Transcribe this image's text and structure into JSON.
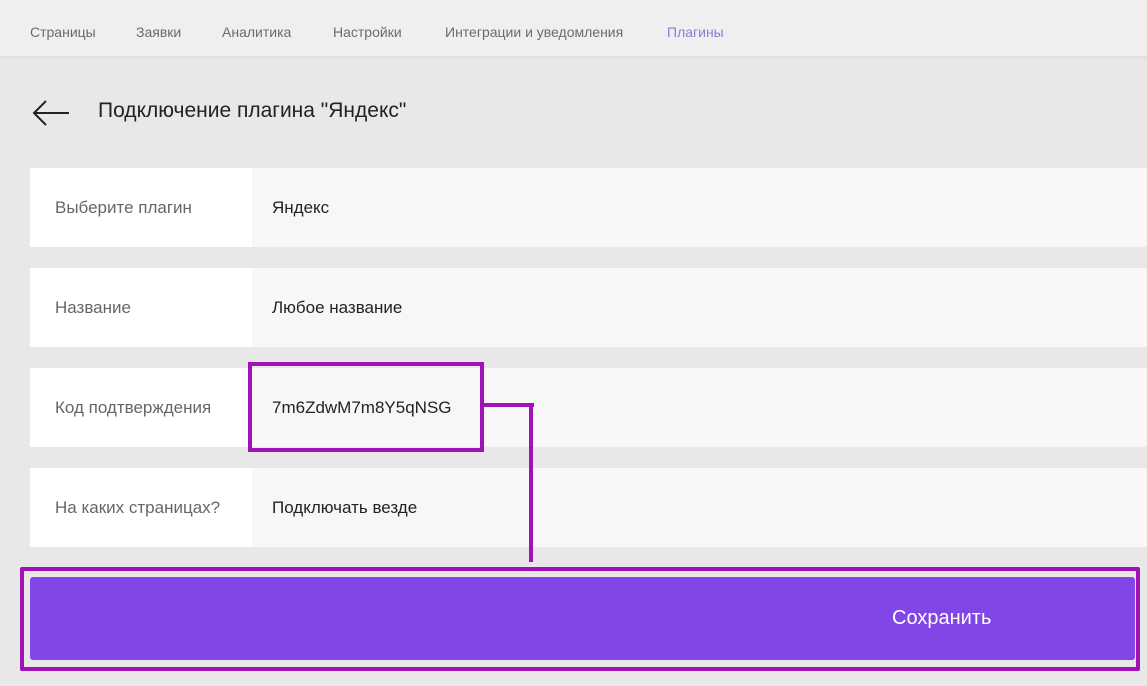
{
  "nav": {
    "items": [
      {
        "label": "Страницы"
      },
      {
        "label": "Заявки"
      },
      {
        "label": "Аналитика"
      },
      {
        "label": "Настройки"
      },
      {
        "label": "Интеграции и уведомления"
      },
      {
        "label": "Плагины",
        "active": true
      }
    ]
  },
  "header": {
    "back_icon": "arrow-left-icon",
    "title": "Подключение плагина \"Яндекс\""
  },
  "form": {
    "rows": [
      {
        "label": "Выберите плагин",
        "value": "Яндекс"
      },
      {
        "label": "Название",
        "value": "Любое название"
      },
      {
        "label": "Код подтверждения",
        "value": "7m6ZdwM7m8Y5qNSG"
      },
      {
        "label": "На каких страницах?",
        "value": "Подключать везде"
      }
    ]
  },
  "actions": {
    "save_label": "Сохранить"
  },
  "colors": {
    "accent": "#8245e6",
    "annotation": "#a011b8",
    "active_nav": "#8e7ad8"
  }
}
